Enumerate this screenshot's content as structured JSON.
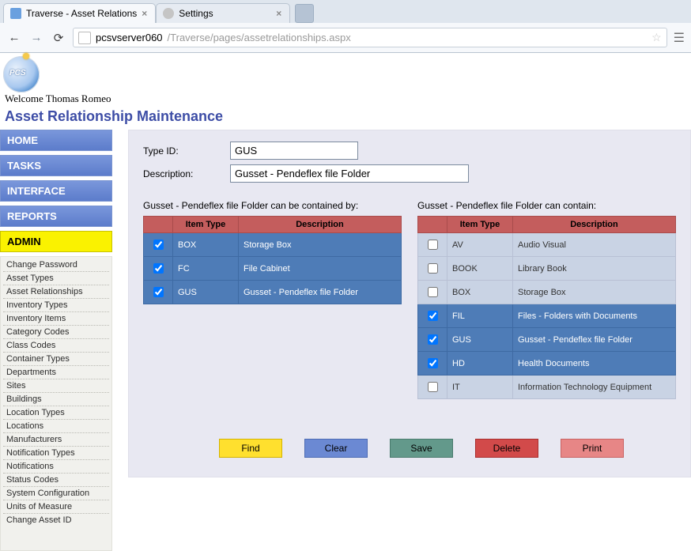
{
  "browser": {
    "tabs": [
      {
        "label": "Traverse - Asset Relations",
        "active": true
      },
      {
        "label": "Settings",
        "active": false
      }
    ],
    "url_host": "pcsvserver060",
    "url_path": "/Traverse/pages/assetrelationships.aspx"
  },
  "app": {
    "logo_text": "PCS",
    "welcome": "Welcome Thomas Romeo",
    "page_title": "Asset Relationship Maintenance"
  },
  "nav": {
    "sections": [
      {
        "label": "HOME",
        "kind": "top"
      },
      {
        "label": "TASKS",
        "kind": "top"
      },
      {
        "label": "INTERFACE",
        "kind": "top"
      },
      {
        "label": "REPORTS",
        "kind": "top"
      },
      {
        "label": "ADMIN",
        "kind": "admin"
      }
    ],
    "admin_items": [
      "Change Password",
      "Asset Types",
      "Asset Relationships",
      "Inventory Types",
      "Inventory Items",
      "Category Codes",
      "Class Codes",
      "Container Types",
      "Departments",
      "Sites",
      "Buildings",
      "Location Types",
      "Locations",
      "Manufacturers",
      "Notification Types",
      "Notifications",
      "Status Codes",
      "System Configuration",
      "Units of Measure",
      "Change Asset ID"
    ]
  },
  "form": {
    "type_id_label": "Type ID:",
    "type_id_value": "GUS",
    "desc_label": "Description:",
    "desc_value": "Gusset - Pendeflex file Folder"
  },
  "tables": {
    "left": {
      "title": "Gusset - Pendeflex file Folder can be contained by:",
      "headers": [
        "",
        "Item Type",
        "Description"
      ],
      "rows": [
        {
          "checked": true,
          "code": "BOX",
          "desc": "Storage Box"
        },
        {
          "checked": true,
          "code": "FC",
          "desc": "File Cabinet"
        },
        {
          "checked": true,
          "code": "GUS",
          "desc": "Gusset - Pendeflex file Folder"
        }
      ]
    },
    "right": {
      "title": "Gusset - Pendeflex file Folder can contain:",
      "headers": [
        "",
        "Item Type",
        "Description"
      ],
      "rows": [
        {
          "checked": false,
          "code": "AV",
          "desc": "Audio Visual"
        },
        {
          "checked": false,
          "code": "BOOK",
          "desc": "Library Book"
        },
        {
          "checked": false,
          "code": "BOX",
          "desc": "Storage Box"
        },
        {
          "checked": true,
          "code": "FIL",
          "desc": "Files - Folders with Documents"
        },
        {
          "checked": true,
          "code": "GUS",
          "desc": "Gusset - Pendeflex file Folder"
        },
        {
          "checked": true,
          "code": "HD",
          "desc": "Health Documents"
        },
        {
          "checked": false,
          "code": "IT",
          "desc": "Information Technology Equipment"
        }
      ]
    }
  },
  "buttons": {
    "find": "Find",
    "clear": "Clear",
    "save": "Save",
    "delete": "Delete",
    "print": "Print"
  }
}
